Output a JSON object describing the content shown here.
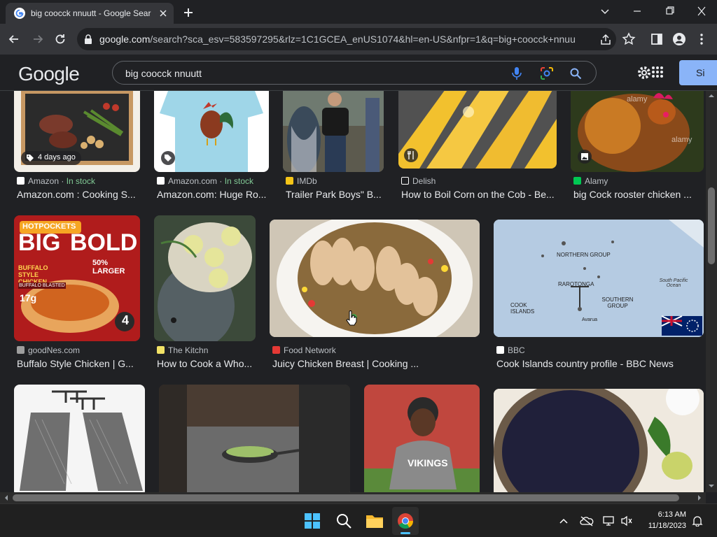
{
  "tab": {
    "title": "big coocck nnuutt - Google Sear",
    "favicon": "google-g-icon"
  },
  "toolbar": {
    "url_domain": "google.com",
    "url_path": "/search?sca_esv=583597295&rlz=1C1GCEA_enUS1074&hl=en-US&nfpr=1&q=big+coocck+nnuutt..."
  },
  "header": {
    "logo": "Google",
    "query": "big coocck nnuutt",
    "signin_label": "Si"
  },
  "results": [
    {
      "badge": "4 days ago",
      "source": "Amazon",
      "stock": "In stock",
      "title": "Amazon.com : Cooking S...",
      "source_color": "#ffffff"
    },
    {
      "source": "Amazon.com",
      "stock": "In stock",
      "title": "Amazon.com: Huge Ro...",
      "source_color": "#ffffff"
    },
    {
      "source": "IMDb",
      "title": "Trailer Park Boys\" B...",
      "source_color": "#f5c518"
    },
    {
      "source": "Delish",
      "title": "How to Boil Corn on the Cob - Be...",
      "source_color": "#ffffff"
    },
    {
      "source": "Alamy",
      "title": "big Cock rooster chicken ...",
      "source_color": "#00c853"
    },
    {
      "source": "goodNes.com",
      "title": "Buffalo Style Chicken | G...",
      "source_color": "#9e9e9e"
    },
    {
      "source": "The Kitchn",
      "title": "How to Cook a Who...",
      "source_color": "#f2e266"
    },
    {
      "source": "Food Network",
      "title": "Juicy Chicken Breast | Cooking ...",
      "source_color": "#e53935"
    },
    {
      "source": "BBC",
      "title": "Cook Islands country profile - BBC News",
      "source_color": "#ffffff"
    }
  ],
  "thumb_text": {
    "hotpockets": "HOTPOCKETS",
    "big": "BIG",
    "bold": "BOLD",
    "larger": "50% LARGER",
    "buffalo": "BUFFALO STYLE CHICKEN",
    "blasted": "BUFFALO BLASTED",
    "protein": "17g",
    "pack": "4",
    "alamy": "alamy",
    "map_northern": "NORTHERN GROUP",
    "map_rarotonga": "RAROTONGA",
    "map_southern": "SOUTHERN GROUP",
    "map_cook": "COOK ISLANDS",
    "map_pacific": "South Pacific Ocean",
    "map_avarua": "Avarua",
    "vikings": "VIKINGS"
  },
  "taskbar": {
    "time": "6:13 AM",
    "date": "11/18/2023"
  }
}
